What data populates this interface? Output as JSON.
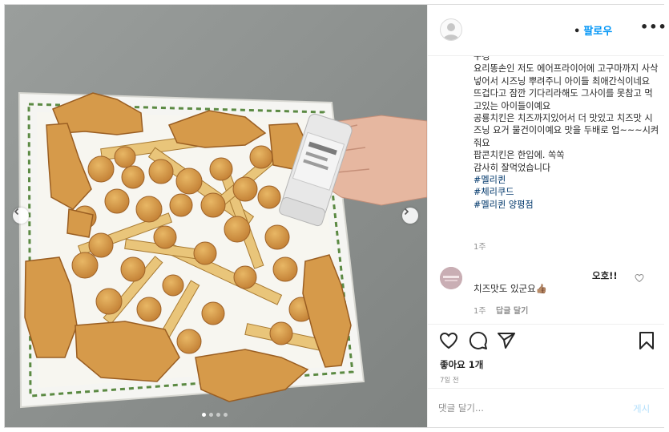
{
  "header": {
    "separator": "•",
    "follow_label": "팔로우",
    "more_label": "•••"
  },
  "caption": {
    "text": "구경\n요리똥손인 저도 에어프라이어에 고구마까지 사삭 넣어서 시즈닝 뿌려주니 아이들 최애간식이네요\n뜨겁다고 잠깐 기다리라해도 그사이를 못참고 먹고있는 아이들이예요\n공룡치킨은 치즈까지있어서 더 맛있고 치즈맛 시즈닝 요거 물건이이예요 맛을 두배로 업~~~시켜줘요\n팝콘치킨은 한입에. 쏙쏙\n감사히 잘먹었습니다",
    "hashtags": [
      "#멜리퀸",
      "#체리쿠드",
      "#멜리퀸 양평점"
    ],
    "time": "1주"
  },
  "comment": {
    "username": "오호!!",
    "text": "치즈맛도 있군요👍🏽",
    "time": "1주",
    "reply_label": "답글 달기"
  },
  "actions": {
    "icons": [
      "heart-icon",
      "comment-icon",
      "share-icon",
      "bookmark-icon"
    ],
    "likes": "좋아요 1개",
    "posted": "7일 전"
  },
  "comment_bar": {
    "placeholder": "댓글 달기...",
    "post_label": "게시"
  },
  "carousel": {
    "slides": 4,
    "active_index": 0
  },
  "colors": {
    "link": "#0095f6",
    "hashtag": "#00376b",
    "muted": "#8e8e8e",
    "post_disabled": "#b2dffc"
  }
}
